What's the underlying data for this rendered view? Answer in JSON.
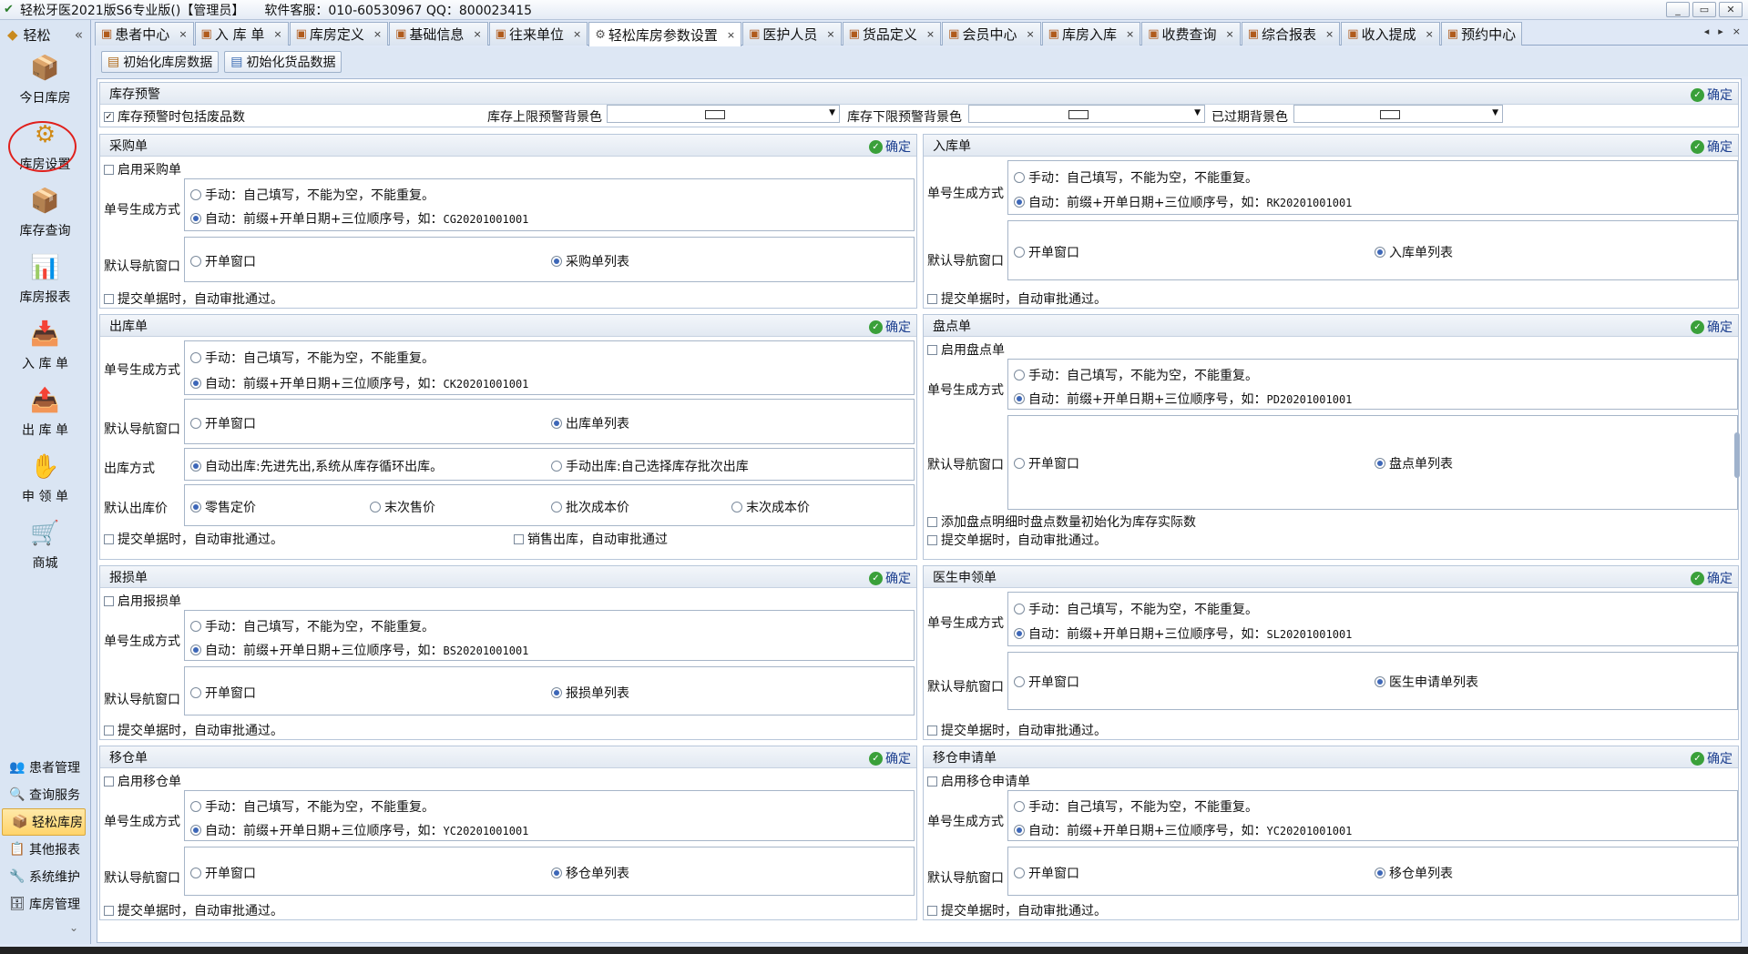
{
  "window": {
    "title": "轻松牙医2021版S6专业版()【管理员】",
    "service": "软件客服：010-60530967 QQ：800023415",
    "btn_min": "_",
    "btn_max": "▭",
    "btn_close": "✕"
  },
  "sidebar": {
    "title": "轻松",
    "collapse": "«",
    "big_items": [
      {
        "label": "今日库房",
        "icon": "📦"
      },
      {
        "label": "库房设置",
        "icon": "⚙"
      },
      {
        "label": "库存查询",
        "icon": "📦"
      },
      {
        "label": "库房报表",
        "icon": "📊"
      },
      {
        "label": "入 库 单",
        "icon": "📥"
      },
      {
        "label": "出 库 单",
        "icon": "📤"
      },
      {
        "label": "申 领 单",
        "icon": "✋"
      },
      {
        "label": "商城",
        "icon": "🛒"
      }
    ],
    "small_items": [
      {
        "label": "患者管理",
        "icon": "👥"
      },
      {
        "label": "查询服务",
        "icon": "🔍"
      },
      {
        "label": "轻松库房",
        "icon": "📦"
      },
      {
        "label": "其他报表",
        "icon": "📋"
      },
      {
        "label": "系统维护",
        "icon": "🔧"
      },
      {
        "label": "库房管理",
        "icon": "🗄"
      }
    ],
    "more": "⌄"
  },
  "tabs": [
    {
      "label": "患者中心"
    },
    {
      "label": "入 库 单"
    },
    {
      "label": "库房定义"
    },
    {
      "label": "基础信息"
    },
    {
      "label": "往来单位"
    },
    {
      "label": "轻松库房参数设置"
    },
    {
      "label": "医护人员"
    },
    {
      "label": "货品定义"
    },
    {
      "label": "会员中心"
    },
    {
      "label": "库房入库"
    },
    {
      "label": "收费查询"
    },
    {
      "label": "综合报表"
    },
    {
      "label": "收入提成"
    },
    {
      "label": "预约中心"
    }
  ],
  "tab_close": "×",
  "tab_prev": "◂",
  "tab_next": "▸",
  "tab_x": "×",
  "toolbar": {
    "init_store": "初始化库房数据",
    "init_goods": "初始化货品数据"
  },
  "common": {
    "confirm": "确定",
    "manual": "手动：自己填写，不能为空，不能重复。",
    "auto_prefix": "自动：前缀+开单日期+三位顺序号，如：",
    "num_gen": "单号生成方式",
    "default_nav": "默认导航窗口",
    "open_window": "开单窗口",
    "submit_auto": "提交单据时，自动审批通过。"
  },
  "stock_warning": {
    "title": "库存预警",
    "include_waste": "库存预警时包括废品数",
    "upper_bg": "库存上限预警背景色",
    "lower_bg": "库存下限预警背景色",
    "expired_bg": "已过期背景色"
  },
  "purchase": {
    "title": "采购单",
    "enable": "启用采购单",
    "example": "CG20201001001",
    "list": "采购单列表"
  },
  "inbound": {
    "title": "入库单",
    "example": "RK20201001001",
    "list": "入库单列表"
  },
  "outbound": {
    "title": "出库单",
    "example": "CK20201001001",
    "list": "出库单列表",
    "out_method": "出库方式",
    "auto_out": "自动出库:先进先出,系统从库存循环出库。",
    "manual_out": "手动出库:自己选择库存批次出库",
    "default_price": "默认出库价",
    "prices": [
      "零售定价",
      "末次售价",
      "批次成本价",
      "末次成本价"
    ],
    "sale_auto": "销售出库，自动审批通过"
  },
  "stocktake": {
    "title": "盘点单",
    "enable": "启用盘点单",
    "example": "PD20201001001",
    "list": "盘点单列表",
    "init_actual": "添加盘点明细时盘点数量初始化为库存实际数"
  },
  "damage": {
    "title": "报损单",
    "enable": "启用报损单",
    "example": "BS20201001001",
    "list": "报损单列表"
  },
  "doctor_req": {
    "title": "医生申领单",
    "example": "SL20201001001",
    "list": "医生申请单列表"
  },
  "transfer": {
    "title": "移仓单",
    "enable": "启用移仓单",
    "example": "YC20201001001",
    "list": "移仓单列表"
  },
  "transfer_req": {
    "title": "移仓申请单",
    "enable": "启用移仓申请单",
    "example": "YC20201001001",
    "list": "移仓单列表"
  }
}
